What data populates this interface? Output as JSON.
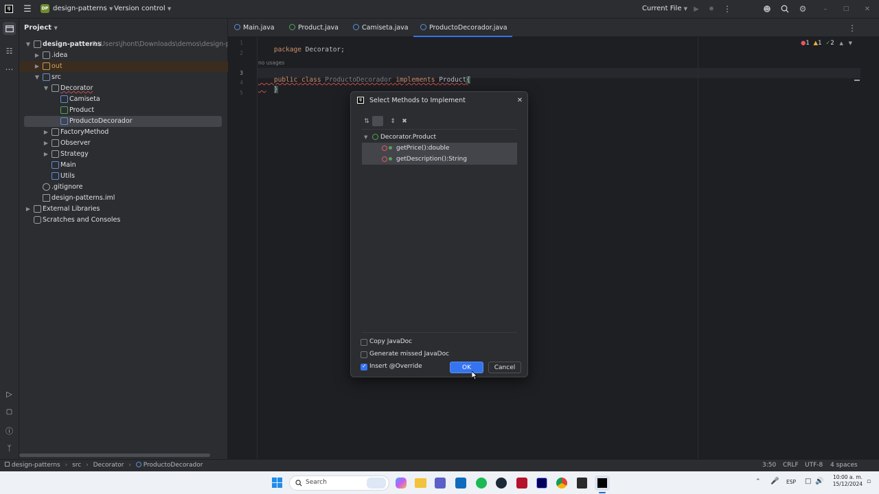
{
  "titlebar": {
    "project_badge": "DP",
    "project_name": "design-patterns",
    "vcs": "Version control",
    "run_config": "Current File"
  },
  "project_panel": {
    "title": "Project",
    "root_name": "design-patterns",
    "root_path": "C:\\Users\\jhont\\Downloads\\demos\\design-patterns",
    "items": [
      {
        "label": ".idea"
      },
      {
        "label": "out"
      },
      {
        "label": "src"
      },
      {
        "label": "Decorator"
      },
      {
        "label": "Camiseta"
      },
      {
        "label": "Product"
      },
      {
        "label": "ProductoDecorador"
      },
      {
        "label": "FactoryMethod"
      },
      {
        "label": "Observer"
      },
      {
        "label": "Strategy"
      },
      {
        "label": "Main"
      },
      {
        "label": "Utils"
      },
      {
        "label": ".gitignore"
      },
      {
        "label": "design-patterns.iml"
      },
      {
        "label": "External Libraries"
      },
      {
        "label": "Scratches and Consoles"
      }
    ]
  },
  "tabs": [
    {
      "label": "Main.java"
    },
    {
      "label": "Product.java"
    },
    {
      "label": "Camiseta.java"
    },
    {
      "label": "ProductoDecorador.java"
    }
  ],
  "editor": {
    "line_numbers": [
      "1",
      "2",
      "3",
      "4",
      "5"
    ],
    "line1_kw": "package",
    "line1_rest": " Decorator;",
    "usages_hint": "no usages",
    "line3_kw1": "public",
    "line3_kw2": "class",
    "line3_class": "ProductoDecorador",
    "line3_kw3": "implements",
    "line3_iface": "Product",
    "line3_brace": "{",
    "line4": "}",
    "inspections": {
      "errors": "1",
      "warnings": "1",
      "weak_warnings": "2"
    }
  },
  "dialog": {
    "title": "Select Methods to Implement",
    "group": "Decorator.Product",
    "methods": [
      {
        "label": "getPrice():double"
      },
      {
        "label": "getDescription():String"
      }
    ],
    "options": [
      {
        "label": "Copy JavaDoc",
        "checked": false
      },
      {
        "label": "Generate missed JavaDoc",
        "checked": false
      },
      {
        "label": "Insert @Override",
        "checked": true
      }
    ],
    "ok_label": "OK",
    "cancel_label": "Cancel"
  },
  "statusbar": {
    "breadcrumb": [
      "design-patterns",
      "src",
      "Decorator",
      "ProductoDecorador"
    ],
    "position": "3:50",
    "line_sep": "CRLF",
    "encoding": "UTF-8",
    "indent": "4 spaces"
  },
  "taskbar": {
    "search_placeholder": "Search",
    "lang": "ESP",
    "time": "10:00 a. m.",
    "date": "15/12/2024"
  },
  "colors": {
    "accent": "#3574f0",
    "keyword": "#cf8e6d",
    "error_red": "#e55765",
    "warning_yellow": "#e8b041",
    "ok_green": "#57a35a"
  }
}
